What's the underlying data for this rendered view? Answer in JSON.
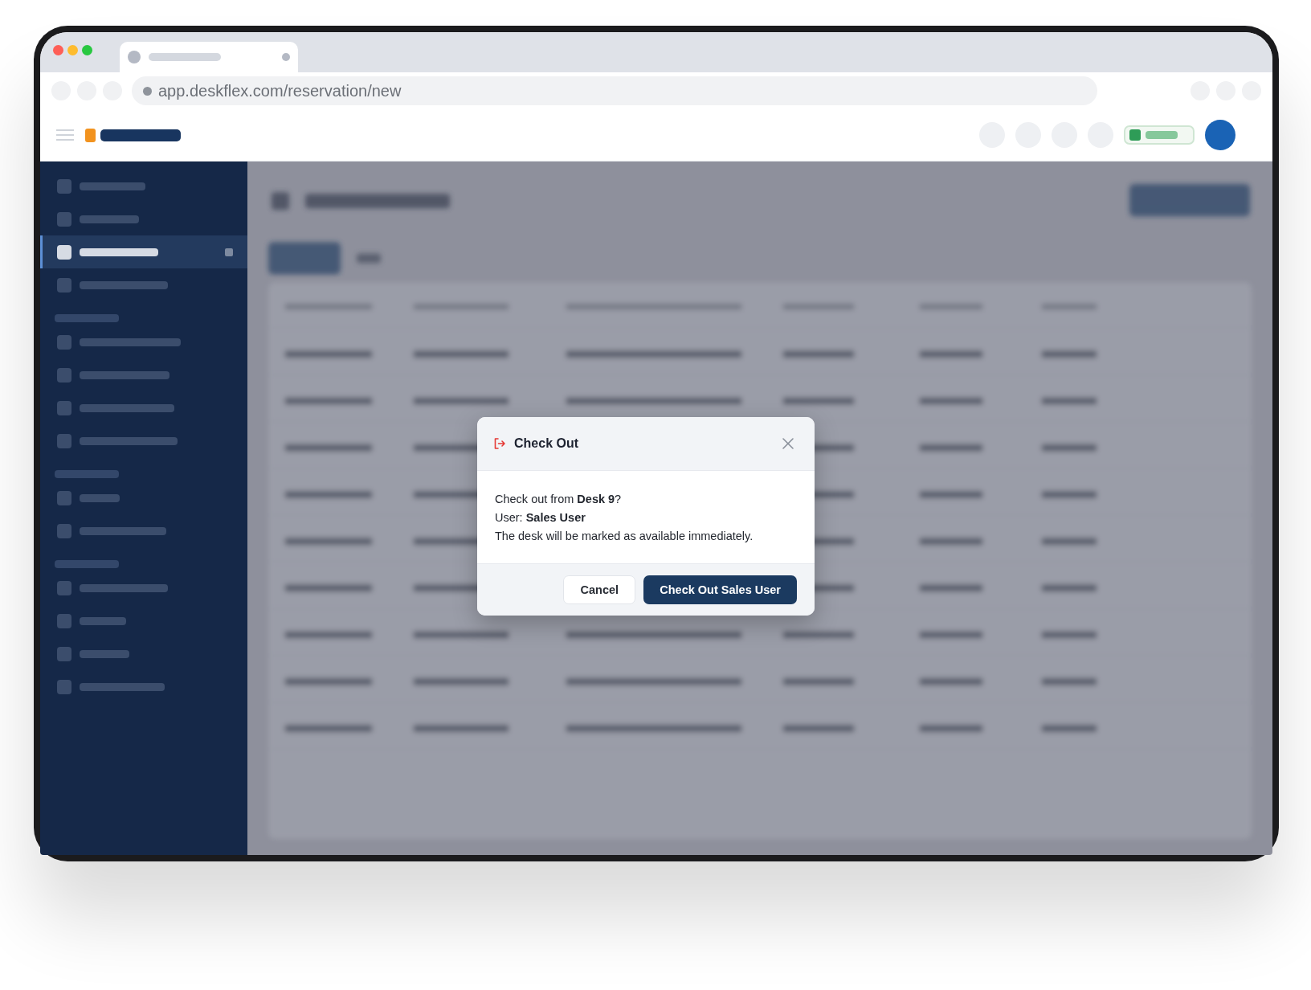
{
  "browser": {
    "url": "app.deskflex.com/reservation/new"
  },
  "sidebar": {
    "groups": [
      {
        "items": [
          {
            "selected": false
          },
          {
            "selected": false
          },
          {
            "selected": true
          },
          {
            "selected": false
          }
        ]
      },
      {
        "items": [
          {
            "selected": false
          },
          {
            "selected": false
          },
          {
            "selected": false
          },
          {
            "selected": false
          }
        ]
      },
      {
        "items": [
          {
            "selected": false
          },
          {
            "selected": false
          }
        ]
      },
      {
        "items": [
          {
            "selected": false
          },
          {
            "selected": false
          },
          {
            "selected": false
          },
          {
            "selected": false
          }
        ]
      }
    ]
  },
  "dialog": {
    "title": "Check Out",
    "lines": [
      "Check out from **Desk 9**?",
      "User: **Sales User**",
      "The desk will be marked as available immediately."
    ],
    "buttons": [
      {
        "label": "Cancel",
        "kind": "secondary"
      },
      {
        "label": "Check Out Sales User",
        "kind": "primary"
      }
    ]
  }
}
